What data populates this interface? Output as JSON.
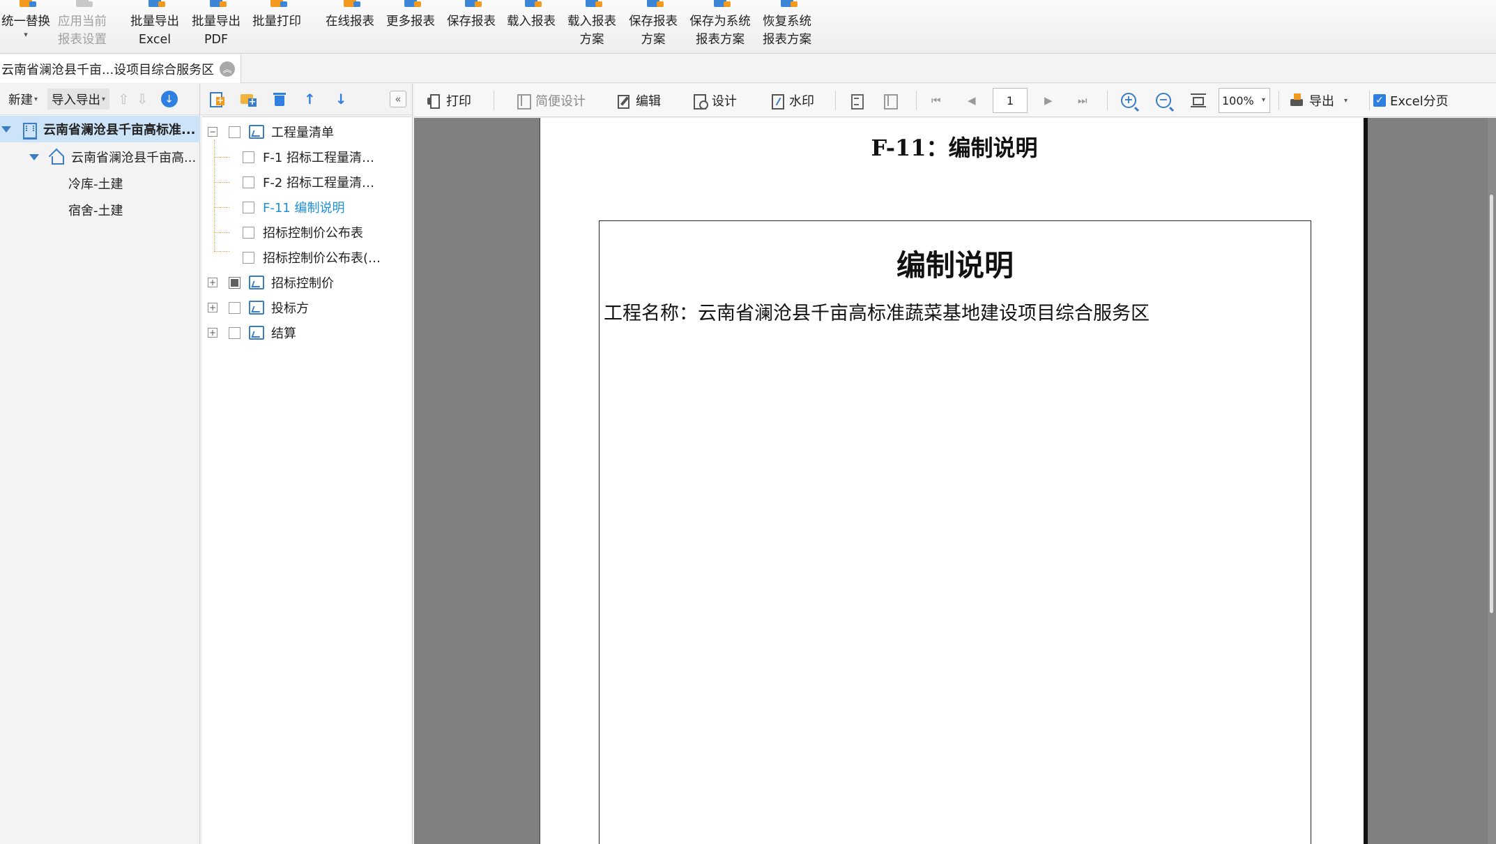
{
  "ribbon": {
    "buttons": [
      {
        "line1": "统一替换",
        "line2": ""
      },
      {
        "line1": "应用当前",
        "line2": "报表设置"
      },
      {
        "line1": "批量导出",
        "line2": "Excel"
      },
      {
        "line1": "批量导出",
        "line2": "PDF"
      },
      {
        "line1": "批量打印",
        "line2": ""
      },
      {
        "line1": "在线报表",
        "line2": ""
      },
      {
        "line1": "更多报表",
        "line2": ""
      },
      {
        "line1": "保存报表",
        "line2": ""
      },
      {
        "line1": "载入报表",
        "line2": ""
      },
      {
        "line1": "载入报表",
        "line2": "方案"
      },
      {
        "line1": "保存报表",
        "line2": "方案"
      },
      {
        "line1": "保存为系统",
        "line2": "报表方案"
      },
      {
        "line1": "恢复系统",
        "line2": "报表方案"
      }
    ]
  },
  "doc_tab": {
    "title": "云南省澜沧县千亩...设项目综合服务区"
  },
  "left_panel": {
    "new_label": "新建",
    "import_export_label": "导入导出",
    "project_root": "云南省澜沧县千亩高标准...",
    "sub_project": "云南省澜沧县千亩高...",
    "units": [
      "冷库-土建",
      "宿舍-土建"
    ]
  },
  "report_tree": {
    "root": "工程量清单",
    "children": [
      "F-1 招标工程量清…",
      "F-2 招标工程量清…",
      "F-11 编制说明",
      "招标控制价公布表",
      "招标控制价公布表(…"
    ],
    "groups": [
      "招标控制价",
      "投标方",
      "结算"
    ]
  },
  "report_toolbar": {
    "print": "打印",
    "simple_design": "简便设计",
    "edit": "编辑",
    "design": "设计",
    "watermark": "水印",
    "page_number": "1",
    "zoom": "100%",
    "export": "导出",
    "excel_paging": "Excel分页"
  },
  "report": {
    "page_heading": "F-11：编制说明",
    "title": "编制说明",
    "project_line": "工程名称：云南省澜沧县千亩高标准蔬菜基地建设项目综合服务区"
  }
}
